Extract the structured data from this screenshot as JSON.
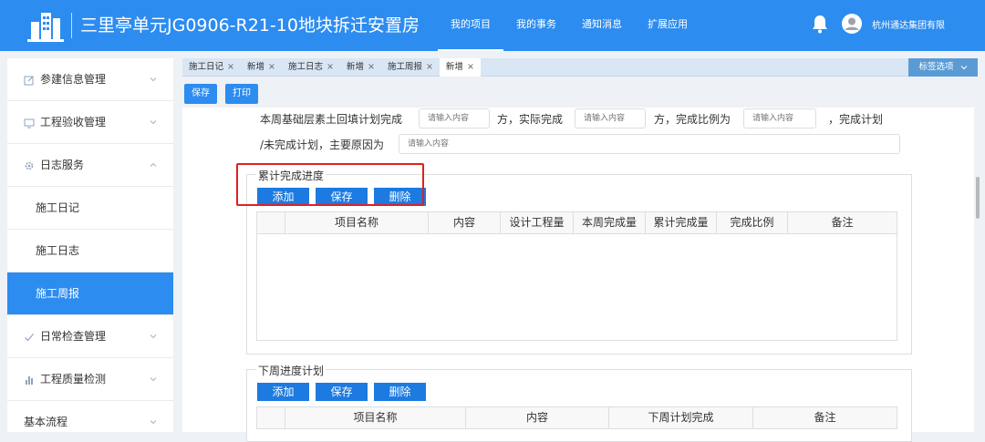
{
  "header": {
    "title": "三里亭单元JG0906-R21-10地块拆迁安置房",
    "nav": [
      {
        "label": "我的项目",
        "active": true
      },
      {
        "label": "我的事务",
        "active": false
      },
      {
        "label": "通知消息",
        "active": false
      },
      {
        "label": "扩展应用",
        "active": false
      }
    ],
    "organization": "杭州通达集团有限"
  },
  "sidebar": {
    "items": [
      {
        "label": "参建信息管理",
        "icon": "edit-icon",
        "chevron": "down"
      },
      {
        "label": "工程验收管理",
        "icon": "monitor-icon",
        "chevron": "down"
      },
      {
        "label": "日志服务",
        "icon": "gear-icon",
        "chevron": "up"
      },
      {
        "label": "施工日记"
      },
      {
        "label": "施工日志"
      },
      {
        "label": "施工周报",
        "active": true
      },
      {
        "label": "日常检查管理",
        "icon": "check-icon",
        "chevron": "down"
      },
      {
        "label": "工程质量检测",
        "icon": "chart-icon",
        "chevron": "down"
      },
      {
        "label": "基本流程",
        "chevron": "down"
      }
    ]
  },
  "tabs": [
    {
      "label": "施工日记",
      "close": "×"
    },
    {
      "label": "新增",
      "close": "×"
    },
    {
      "label": "施工日志",
      "close": "×"
    },
    {
      "label": "新增",
      "close": "×"
    },
    {
      "label": "施工周报",
      "close": "×"
    },
    {
      "label": "新增",
      "close": "×",
      "active": true
    }
  ],
  "tag_options": "标签选项",
  "toolbar": {
    "save": "保存",
    "print": "打印"
  },
  "form": {
    "line1_a": "本周基础层素土回填计划完成",
    "line1_b": "方，实际完成",
    "line1_c": "方，完成比例为",
    "line1_d": "，完成计划",
    "line2_a": "/未完成计划，主要原因为",
    "placeholder": "请输入内容"
  },
  "section1": {
    "title": "累计完成进度",
    "buttons": {
      "add": "添加",
      "save": "保存",
      "delete": "删除"
    },
    "columns": [
      "项目名称",
      "内容",
      "设计工程量",
      "本周完成量",
      "累计完成量",
      "完成比例",
      "备注"
    ]
  },
  "section2": {
    "title": "下周进度计划",
    "buttons": {
      "add": "添加",
      "save": "保存",
      "delete": "删除"
    },
    "columns": [
      "项目名称",
      "内容",
      "下周计划完成",
      "备注"
    ]
  },
  "colors": {
    "primary": "#2d8cf0",
    "button": "#1c7ae0",
    "highlight": "#e02020"
  }
}
